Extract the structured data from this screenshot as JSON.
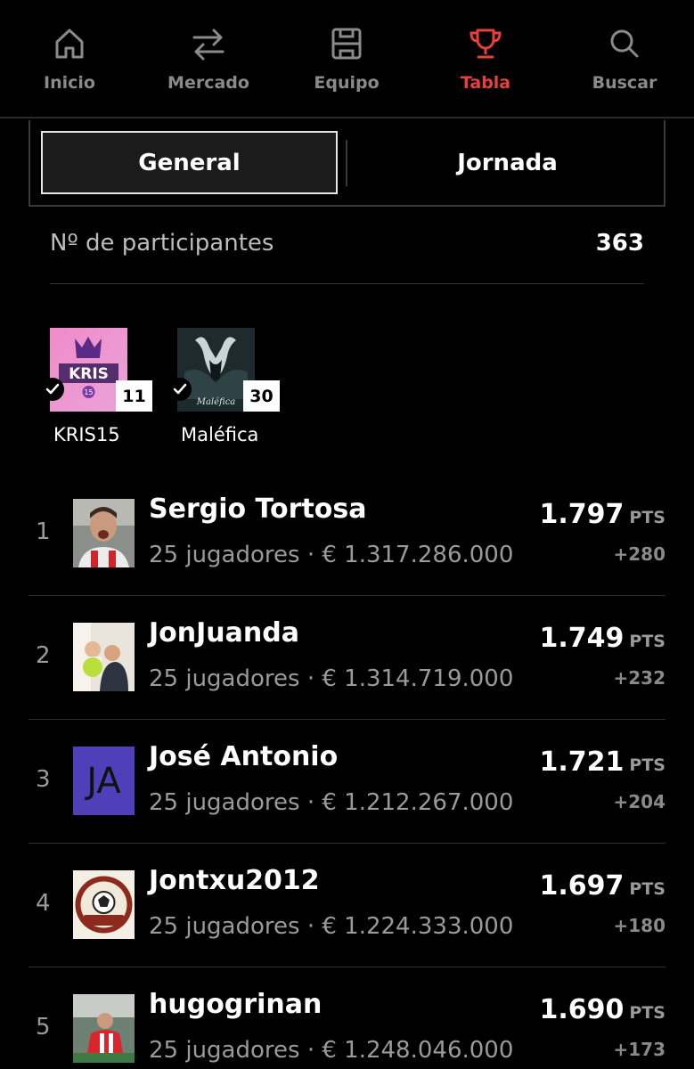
{
  "nav": {
    "items": [
      {
        "label": "Inicio",
        "icon": "home-icon"
      },
      {
        "label": "Mercado",
        "icon": "transfer-arrows-icon"
      },
      {
        "label": "Equipo",
        "icon": "pitch-icon"
      },
      {
        "label": "Tabla",
        "icon": "trophy-icon",
        "active": true
      },
      {
        "label": "Buscar",
        "icon": "search-icon"
      }
    ],
    "active_color": "#e5403b",
    "inactive_color": "#8a8a8a"
  },
  "segment": {
    "general_label": "General",
    "jornada_label": "Jornada",
    "selected": "General"
  },
  "participants": {
    "label": "Nº de participantes",
    "count": "363"
  },
  "leagues": [
    {
      "name": "KRIS15",
      "badge": "11",
      "logo": "kris15-logo"
    },
    {
      "name": "Maléfica",
      "badge": "30",
      "logo": "malefica-logo"
    }
  ],
  "ranking": [
    {
      "rank": "1",
      "name": "Sergio Tortosa",
      "detail": "25 jugadores · € 1.317.286.000",
      "points": "1.797",
      "unit": "PTS",
      "delta": "+280"
    },
    {
      "rank": "2",
      "name": "JonJuanda",
      "detail": "25 jugadores · € 1.314.719.000",
      "points": "1.749",
      "unit": "PTS",
      "delta": "+232"
    },
    {
      "rank": "3",
      "name": "José Antonio",
      "detail": "25 jugadores · € 1.212.267.000",
      "points": "1.721",
      "unit": "PTS",
      "delta": "+204",
      "initials": "JA"
    },
    {
      "rank": "4",
      "name": "Jontxu2012",
      "detail": "25 jugadores · € 1.224.333.000",
      "points": "1.697",
      "unit": "PTS",
      "delta": "+180"
    },
    {
      "rank": "5",
      "name": "hugogrinan",
      "detail": "25 jugadores · € 1.248.046.000",
      "points": "1.690",
      "unit": "PTS",
      "delta": "+173"
    }
  ]
}
